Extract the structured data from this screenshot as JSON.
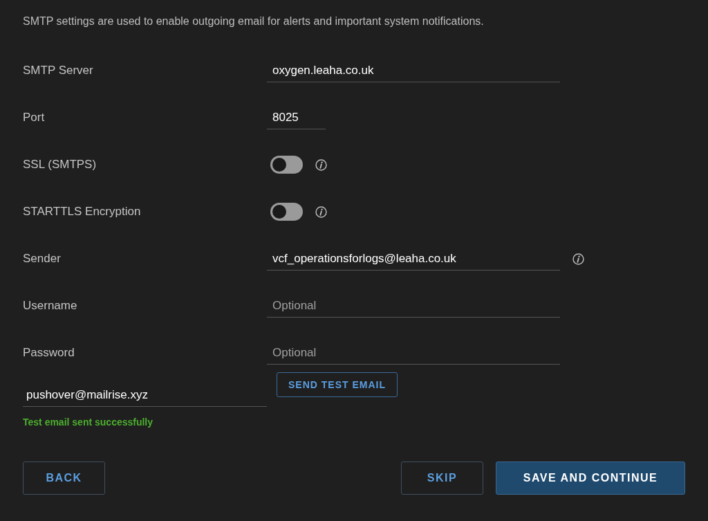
{
  "intro": "SMTP settings are used to enable outgoing email for alerts and important system notifications.",
  "fields": [
    {
      "kind": "text",
      "label": "SMTP Server",
      "value": "oxygen.leaha.co.uk",
      "info": false
    },
    {
      "kind": "short_text",
      "label": "Port",
      "value": "8025",
      "info": false
    },
    {
      "kind": "toggle",
      "label": "SSL (SMTPS)",
      "on": false,
      "info": true
    },
    {
      "kind": "toggle",
      "label": "STARTTLS Encryption",
      "on": false,
      "info": true
    },
    {
      "kind": "text",
      "label": "Sender",
      "value": "vcf_operationsforlogs@leaha.co.uk",
      "info": true
    },
    {
      "kind": "text",
      "label": "Username",
      "placeholder": "Optional",
      "info": false
    },
    {
      "kind": "text",
      "label": "Password",
      "placeholder": "Optional",
      "info": false
    }
  ],
  "test": {
    "recipient": "pushover@mailrise.xyz",
    "button": "SEND TEST EMAIL",
    "message": "Test email sent successfully"
  },
  "footer": {
    "back": "BACK",
    "skip": "SKIP",
    "save": "SAVE AND CONTINUE"
  }
}
